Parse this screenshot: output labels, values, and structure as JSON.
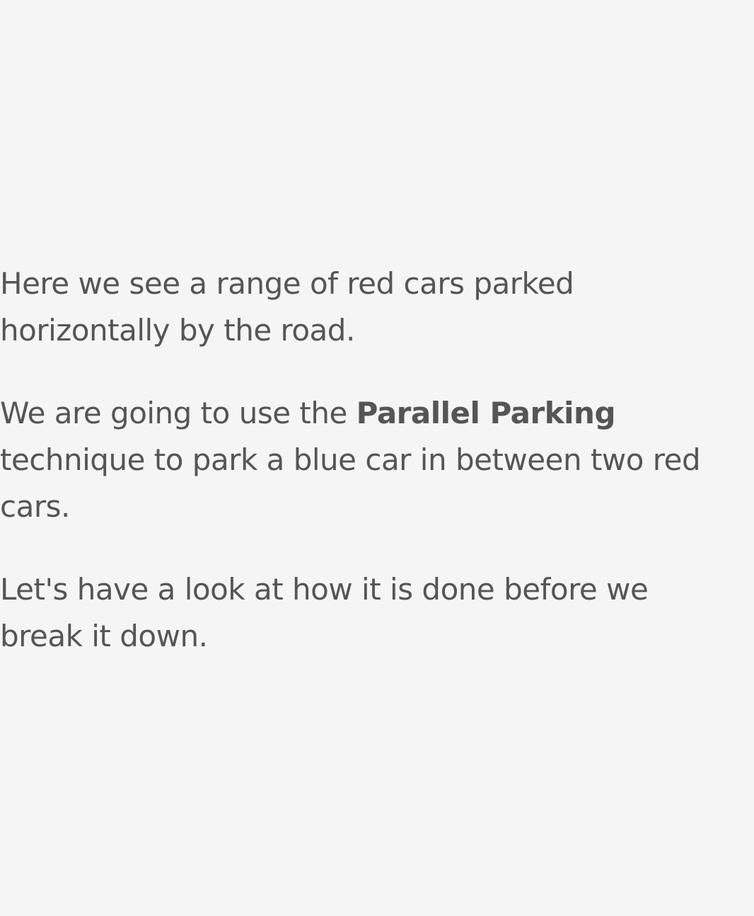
{
  "paragraphs": {
    "intro": "Here we see a range of red cars parked horizontally by the road.",
    "technique_before": "We are going to use the ",
    "technique_bold": "Parallel Parking",
    "technique_after": " technique to park a blue car in between two red cars.",
    "outro": "Let's have a look at how it is done before we break it down."
  },
  "colors": {
    "background": "#f5f5f5",
    "text": "#555555"
  }
}
